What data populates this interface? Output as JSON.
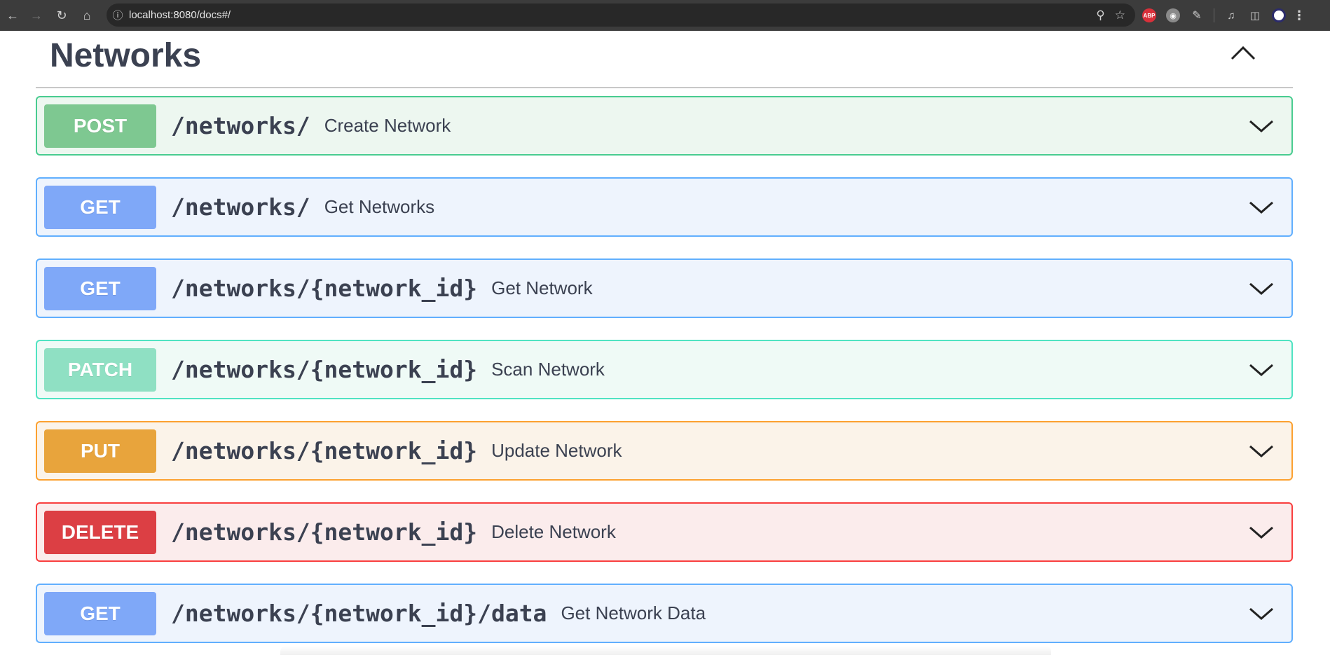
{
  "browser": {
    "url": "localhost:8080/docs#/",
    "extensions": [
      {
        "name": "abp-icon",
        "label": "ABP"
      }
    ]
  },
  "section": {
    "title": "Networks"
  },
  "operations": [
    {
      "method": "POST",
      "path": "/networks/",
      "summary": "Create Network"
    },
    {
      "method": "GET",
      "path": "/networks/",
      "summary": "Get Networks"
    },
    {
      "method": "GET",
      "path": "/networks/{network_id}",
      "summary": "Get Network"
    },
    {
      "method": "PATCH",
      "path": "/networks/{network_id}",
      "summary": "Scan Network"
    },
    {
      "method": "PUT",
      "path": "/networks/{network_id}",
      "summary": "Update Network"
    },
    {
      "method": "DELETE",
      "path": "/networks/{network_id}",
      "summary": "Delete Network"
    },
    {
      "method": "GET",
      "path": "/networks/{network_id}/data",
      "summary": "Get Network Data"
    }
  ],
  "colors": {
    "post": "#49cc90",
    "get": "#61affe",
    "patch": "#50e3c2",
    "put": "#fca130",
    "delete": "#f93e3e",
    "text": "#3b4151"
  }
}
